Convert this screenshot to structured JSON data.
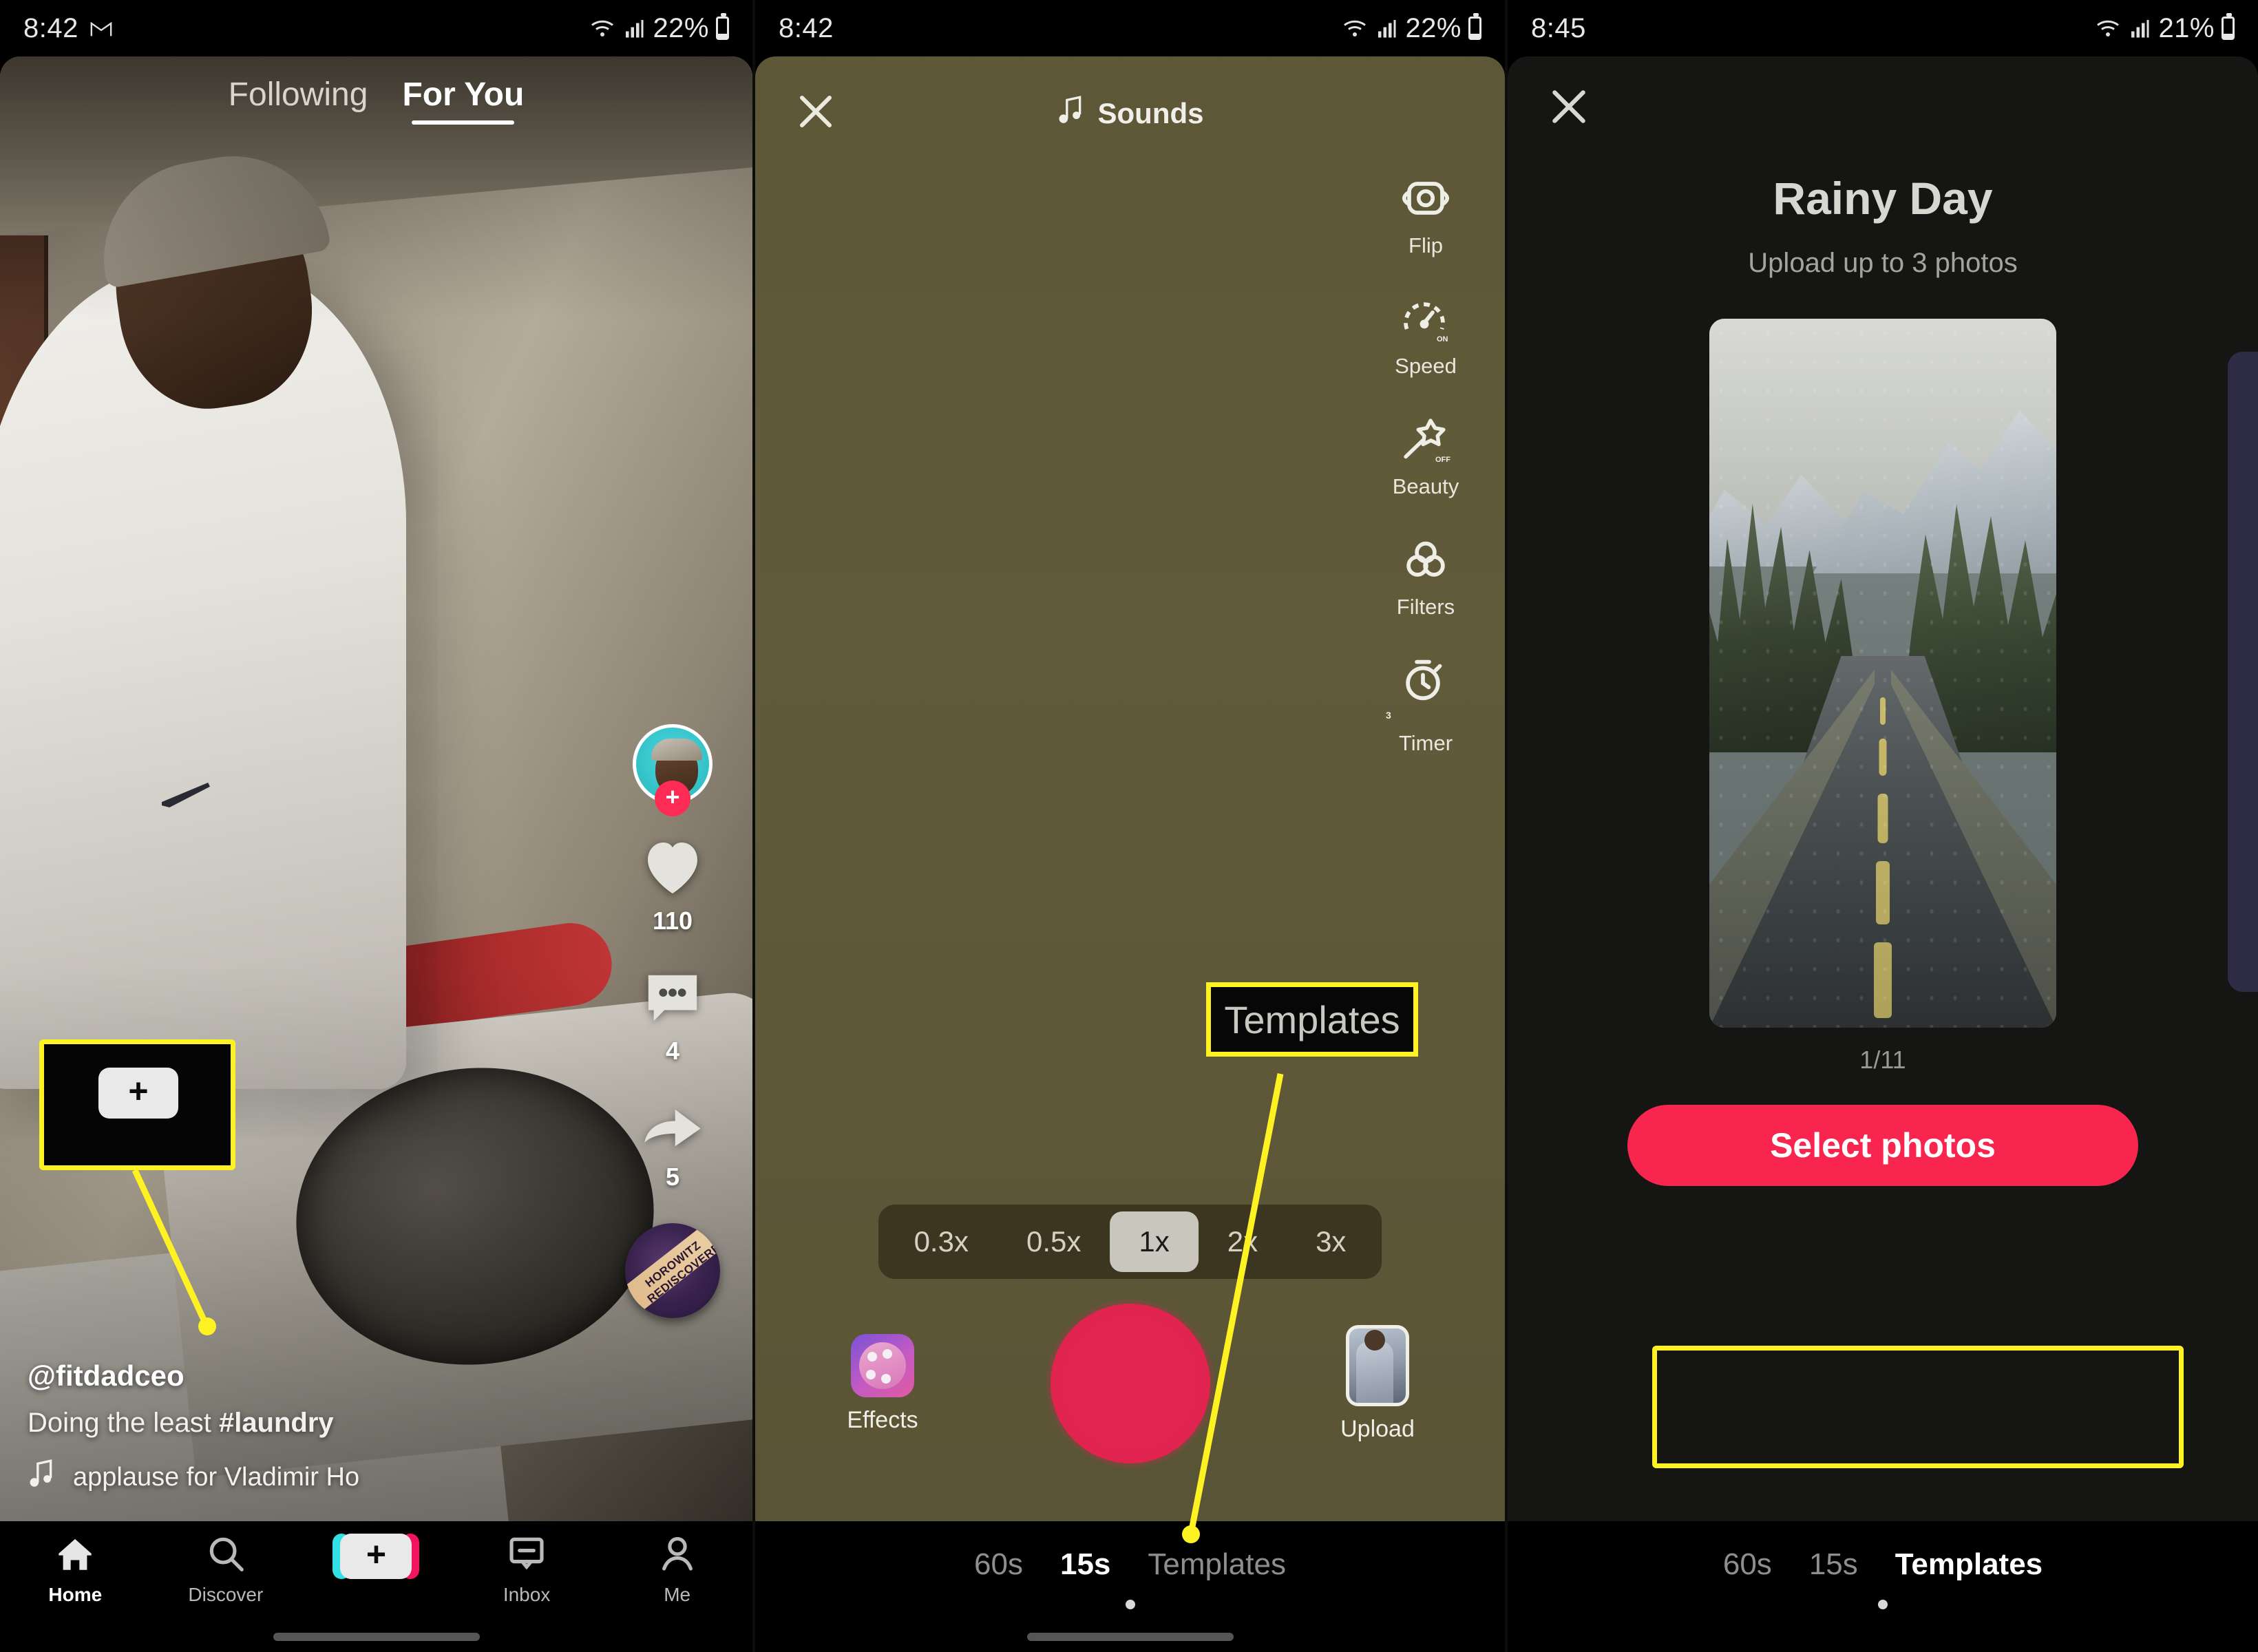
{
  "statusbars": [
    {
      "time": "8:42",
      "mail_icon": "gmail-icon",
      "wifi_icon": "wifi-icon",
      "signal_icon": "signal-icon",
      "battery": "22%"
    },
    {
      "time": "8:42",
      "wifi_icon": "wifi-icon",
      "signal_icon": "signal-icon",
      "battery": "22%"
    },
    {
      "time": "8:45",
      "wifi_icon": "wifi-icon",
      "signal_icon": "signal-icon",
      "battery": "21%"
    }
  ],
  "panel1": {
    "tabs": [
      {
        "label": "Following",
        "active": false
      },
      {
        "label": "For You",
        "active": true
      }
    ],
    "rail": {
      "avatar_icon": "avatar",
      "follow_icon": "plus-icon",
      "follow_label": "+",
      "like_icon": "heart-icon",
      "like_count": "110",
      "comment_icon": "comment-icon",
      "comment_count": "4",
      "share_icon": "share-arrow-icon",
      "share_count": "5",
      "disc_icon": "music-disc-icon",
      "disc_text": "HOROWITZ REDISCOVERED"
    },
    "caption": {
      "username": "@fitdadceo",
      "text_plain": "Doing the least ",
      "text_hashtag": "#laundry",
      "music_icon": "music-note-icon",
      "music_title": "applause for Vladimir Ho"
    },
    "nav": [
      {
        "label": "Home",
        "icon": "home-icon",
        "active": true
      },
      {
        "label": "Discover",
        "icon": "search-icon",
        "active": false
      },
      {
        "label": "",
        "icon": "tiktok-plus-icon",
        "active": false
      },
      {
        "label": "Inbox",
        "icon": "inbox-icon",
        "active": false
      },
      {
        "label": "Me",
        "icon": "person-icon",
        "active": false
      }
    ]
  },
  "panel2": {
    "close_icon": "close-x-icon",
    "sounds_icon": "music-note-icon",
    "sounds_label": "Sounds",
    "rail": [
      {
        "label": "Flip",
        "icon": "flip-camera-icon"
      },
      {
        "label": "Speed",
        "icon": "speed-on-icon"
      },
      {
        "label": "Beauty",
        "icon": "beauty-wand-off-icon"
      },
      {
        "label": "Filters",
        "icon": "filters-icon"
      },
      {
        "label": "Timer",
        "icon": "timer-3-icon"
      }
    ],
    "speeds": [
      {
        "label": "0.3x",
        "active": false
      },
      {
        "label": "0.5x",
        "active": false
      },
      {
        "label": "1x",
        "active": true
      },
      {
        "label": "2x",
        "active": false
      },
      {
        "label": "3x",
        "active": false
      }
    ],
    "effects_label": "Effects",
    "effects_icon": "effects-palette-icon",
    "record_icon": "record-button",
    "upload_label": "Upload",
    "upload_icon": "upload-thumbnail-icon",
    "modes": [
      {
        "label": "60s",
        "active": false
      },
      {
        "label": "15s",
        "active": true
      },
      {
        "label": "Templates",
        "active": false
      }
    ]
  },
  "panel3": {
    "close_icon": "close-x-icon",
    "title": "Rainy Day",
    "subtitle": "Upload up to 3 photos",
    "preview_icon": "rainy-road-photo",
    "counter": "1/11",
    "select_button": "Select photos",
    "modes": [
      {
        "label": "60s",
        "active": false
      },
      {
        "label": "15s",
        "active": false
      },
      {
        "label": "Templates",
        "active": true
      }
    ]
  },
  "annotations": {
    "callout_templates": "Templates",
    "highlight_color": "#fff223"
  }
}
